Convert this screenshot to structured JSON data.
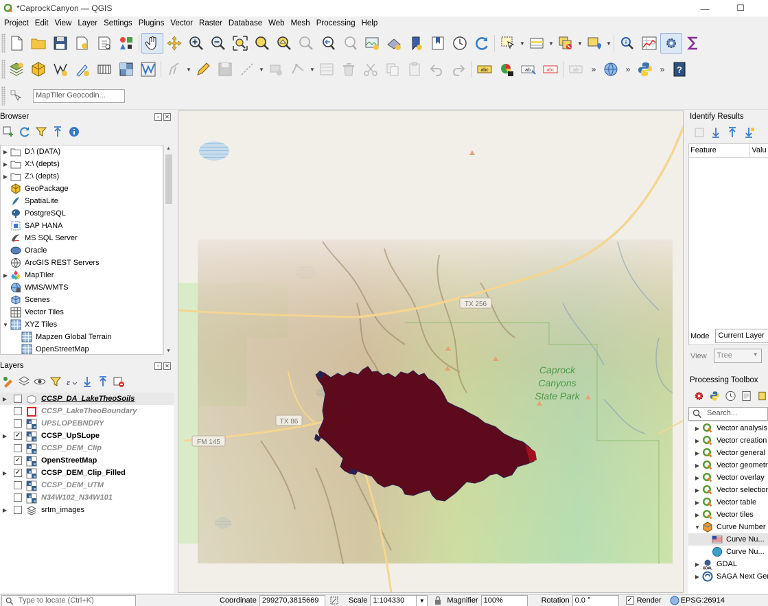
{
  "window": {
    "title": "*CaprockCanyon — QGIS",
    "minimize_glyph": "—",
    "maximize_glyph": "☐"
  },
  "menu": [
    "Project",
    "Edit",
    "View",
    "Layer",
    "Settings",
    "Plugins",
    "Vector",
    "Raster",
    "Database",
    "Web",
    "Mesh",
    "Processing",
    "Help"
  ],
  "toolbar3": {
    "geocoder_placeholder": "MapTiler Geocodin..."
  },
  "browser": {
    "title": "Browser",
    "items": [
      {
        "label": "D:\\ (DATA)",
        "icon": "folder-icon",
        "expand": "▶",
        "indent": 0
      },
      {
        "label": "X:\\ (depts)",
        "icon": "folder-icon",
        "expand": "▶",
        "indent": 0
      },
      {
        "label": "Z:\\ (depts)",
        "icon": "folder-icon",
        "expand": "▶",
        "indent": 0
      },
      {
        "label": "GeoPackage",
        "icon": "geopackage-icon",
        "expand": "",
        "indent": 0
      },
      {
        "label": "SpatiaLite",
        "icon": "spatialite-icon",
        "expand": "",
        "indent": 0
      },
      {
        "label": "PostgreSQL",
        "icon": "postgresql-icon",
        "expand": "",
        "indent": 0
      },
      {
        "label": "SAP HANA",
        "icon": "sap-hana-icon",
        "expand": "",
        "indent": 0
      },
      {
        "label": "MS SQL Server",
        "icon": "mssql-icon",
        "expand": "",
        "indent": 0
      },
      {
        "label": "Oracle",
        "icon": "oracle-icon",
        "expand": "",
        "indent": 0
      },
      {
        "label": "ArcGIS REST Servers",
        "icon": "arcgis-icon",
        "expand": "",
        "indent": 0
      },
      {
        "label": "MapTiler",
        "icon": "maptiler-icon",
        "expand": "▶",
        "indent": 0
      },
      {
        "label": "WMS/WMTS",
        "icon": "wms-icon",
        "expand": "",
        "indent": 0
      },
      {
        "label": "Scenes",
        "icon": "scenes-icon",
        "expand": "",
        "indent": 0
      },
      {
        "label": "Vector Tiles",
        "icon": "vector-tiles-icon",
        "expand": "",
        "indent": 0
      },
      {
        "label": "XYZ Tiles",
        "icon": "xyz-tiles-icon",
        "expand": "▼",
        "indent": 0
      },
      {
        "label": "Mapzen Global Terrain",
        "icon": "xyz-tiles-icon",
        "expand": "",
        "indent": 1
      },
      {
        "label": "OpenStreetMap",
        "icon": "xyz-tiles-icon",
        "expand": "",
        "indent": 1
      }
    ]
  },
  "layers": {
    "title": "Layers",
    "items": [
      {
        "name": "CCSP_DA_LakeTheoSoils",
        "checked": false,
        "expand": "▶",
        "icon": "polygon-layer-icon",
        "style": "ul",
        "selected": true
      },
      {
        "name": "CCSP_LakeTheoBoundary",
        "checked": false,
        "expand": "",
        "icon": "boundary-layer-icon",
        "style": "off",
        "selected": false
      },
      {
        "name": "UPSLOPEBNDRY",
        "checked": false,
        "expand": "",
        "icon": "raster-layer-icon",
        "style": "off",
        "selected": false
      },
      {
        "name": "CCSP_UpSLope",
        "checked": true,
        "expand": "▶",
        "icon": "raster-layer-icon",
        "style": "on",
        "selected": false
      },
      {
        "name": "CCSP_DEM_Clip",
        "checked": false,
        "expand": "",
        "icon": "raster-layer-icon",
        "style": "off",
        "selected": false
      },
      {
        "name": "OpenStreetMap",
        "checked": true,
        "expand": "",
        "icon": "raster-layer-icon",
        "style": "on",
        "selected": false
      },
      {
        "name": "CCSP_DEM_Clip_Filled",
        "checked": true,
        "expand": "▶",
        "icon": "raster-layer-icon",
        "style": "on",
        "selected": false
      },
      {
        "name": "CCSP_DEM_UTM",
        "checked": false,
        "expand": "",
        "icon": "raster-layer-icon",
        "style": "off",
        "selected": false
      },
      {
        "name": "N34W102_N34W101",
        "checked": false,
        "expand": "",
        "icon": "raster-layer-icon",
        "style": "off",
        "selected": false
      },
      {
        "name": "srtm_images",
        "checked": false,
        "expand": "▶",
        "icon": "group-layer-icon",
        "style": "plain",
        "selected": false
      }
    ]
  },
  "map": {
    "labels": {
      "tx256": "TX 256",
      "tx86": "TX 86",
      "fm145": "FM 145",
      "park_line1": "Caprock",
      "park_line2": "Canyons",
      "park_line3": "State Park"
    },
    "colors": {
      "basemap": "#f2efe9",
      "watershed": "#5c0a1c",
      "road": "#f5d590",
      "park_text": "#4a9a4a"
    }
  },
  "identify": {
    "title": "Identify Results",
    "col_feature": "Feature",
    "col_value": "Valu",
    "mode_label": "Mode",
    "mode_value": "Current Layer",
    "view_label": "View",
    "view_value": "Tree"
  },
  "toolbox": {
    "title": "Processing Toolbox",
    "search_placeholder": "Search...",
    "items": [
      {
        "label": "Vector analysis",
        "icon": "qgis-algo-icon",
        "expand": "▶",
        "indent": 0
      },
      {
        "label": "Vector creation",
        "icon": "qgis-algo-icon",
        "expand": "▶",
        "indent": 0
      },
      {
        "label": "Vector general",
        "icon": "qgis-algo-icon",
        "expand": "▶",
        "indent": 0
      },
      {
        "label": "Vector geometry",
        "icon": "qgis-algo-icon",
        "expand": "▶",
        "indent": 0
      },
      {
        "label": "Vector overlay",
        "icon": "qgis-algo-icon",
        "expand": "▶",
        "indent": 0
      },
      {
        "label": "Vector selection",
        "icon": "qgis-algo-icon",
        "expand": "▶",
        "indent": 0
      },
      {
        "label": "Vector table",
        "icon": "qgis-algo-icon",
        "expand": "▶",
        "indent": 0
      },
      {
        "label": "Vector tiles",
        "icon": "qgis-algo-icon",
        "expand": "▶",
        "indent": 0
      },
      {
        "label": "Curve Number",
        "icon": "curve-number-provider-icon",
        "expand": "▼",
        "indent": 0
      },
      {
        "label": "Curve Nu...",
        "icon": "us-flag-icon",
        "expand": "",
        "indent": 1
      },
      {
        "label": "Curve Nu...",
        "icon": "globe-icon",
        "expand": "",
        "indent": 1
      },
      {
        "label": "GDAL",
        "icon": "gdal-icon",
        "expand": "▶",
        "indent": 0
      },
      {
        "label": "SAGA Next Gen",
        "icon": "saga-icon",
        "expand": "▶",
        "indent": 0
      }
    ]
  },
  "status": {
    "locate_placeholder": "Type to locate (Ctrl+K)",
    "coordinate_label": "Coordinate",
    "coordinate_value": "299270,3815669",
    "scale_label": "Scale",
    "scale_value": "1:104330",
    "magnifier_label": "Magnifier",
    "magnifier_value": "100%",
    "rotation_label": "Rotation",
    "rotation_value": "0.0 °",
    "render_label": "Render",
    "epsg": "EPSG:26914"
  }
}
